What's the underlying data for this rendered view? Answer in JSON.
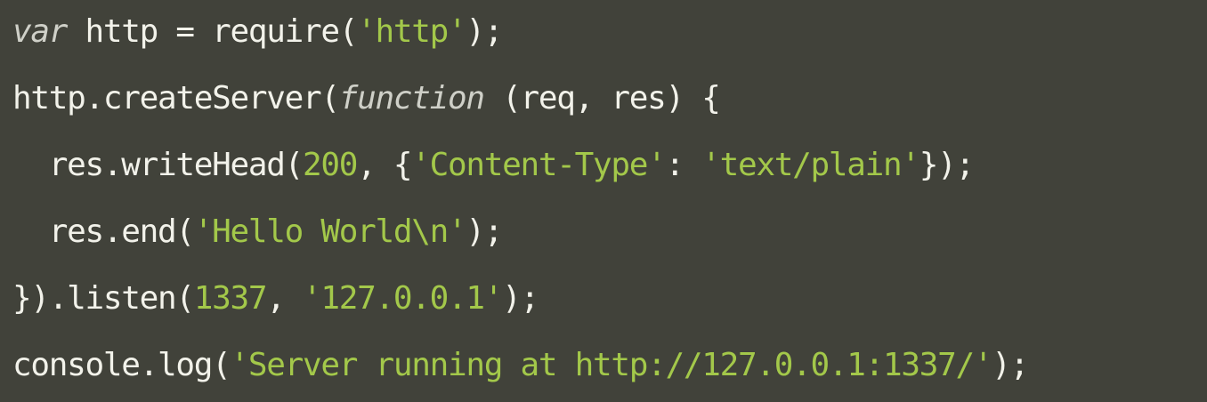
{
  "editor": {
    "language": "javascript",
    "colors": {
      "background": "#41423a",
      "plain": "#f2f2ea",
      "keyword": "#cfd0c8",
      "string": "#a3c84a",
      "number": "#a3c84a"
    },
    "lines": [
      [
        {
          "type": "kw",
          "text": "var"
        },
        {
          "type": "plain",
          "text": " http = require("
        },
        {
          "type": "str",
          "text": "'http'"
        },
        {
          "type": "plain",
          "text": ");"
        }
      ],
      [
        {
          "type": "plain",
          "text": "http.createServer("
        },
        {
          "type": "kw",
          "text": "function"
        },
        {
          "type": "plain",
          "text": " (req, res) {"
        }
      ],
      [
        {
          "type": "plain",
          "text": "  res.writeHead("
        },
        {
          "type": "num",
          "text": "200"
        },
        {
          "type": "plain",
          "text": ", {"
        },
        {
          "type": "str",
          "text": "'Content-Type'"
        },
        {
          "type": "plain",
          "text": ": "
        },
        {
          "type": "str",
          "text": "'text/plain'"
        },
        {
          "type": "plain",
          "text": "});"
        }
      ],
      [
        {
          "type": "plain",
          "text": "  res.end("
        },
        {
          "type": "str",
          "text": "'Hello World\\n'"
        },
        {
          "type": "plain",
          "text": ");"
        }
      ],
      [
        {
          "type": "plain",
          "text": "}).listen("
        },
        {
          "type": "num",
          "text": "1337"
        },
        {
          "type": "plain",
          "text": ", "
        },
        {
          "type": "str",
          "text": "'127.0.0.1'"
        },
        {
          "type": "plain",
          "text": ");"
        }
      ],
      [
        {
          "type": "plain",
          "text": "console.log("
        },
        {
          "type": "str",
          "text": "'Server running at http://127.0.0.1:1337/'"
        },
        {
          "type": "plain",
          "text": ");"
        }
      ]
    ]
  }
}
